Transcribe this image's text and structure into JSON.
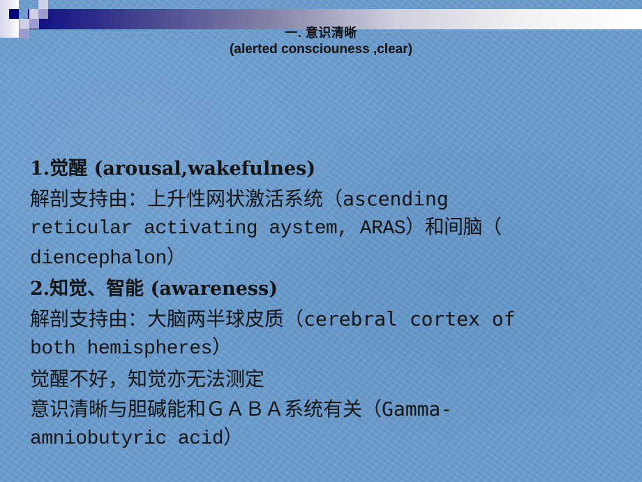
{
  "slide": {
    "title_cn": "一. 意识清晰",
    "title_en": "(alerted consciouness ,clear)",
    "lines": [
      {
        "text": "1.觉醒  (arousal,wakefulnes)",
        "style": "bold"
      },
      {
        "text": "解剖支持由：上升性网状激活系统（ascending",
        "style": "normal"
      },
      {
        "text": "reticular activating aystem, ARAS）和间脑（",
        "style": "normal"
      },
      {
        "text": "diencephalon）",
        "style": "normal"
      },
      {
        "text": "2.知觉、智能  (awareness)",
        "style": "bold"
      },
      {
        "text": "解剖支持由：大脑两半球皮质（cerebral cortex of",
        "style": "normal"
      },
      {
        "text": "both hemispheres）",
        "style": "normal"
      },
      {
        "text": "觉醒不好，知觉亦无法测定",
        "style": "normal"
      },
      {
        "text": "意识清晰与胆碱能和ＧＡＢＡ系统有关（Gamma-",
        "style": "normal"
      },
      {
        "text": "amniobutyric acid）",
        "style": "normal"
      }
    ]
  },
  "theme": {
    "background": "#6b9dcf",
    "accent_navy": "#06067a",
    "accent_lavender": "#9c9cce",
    "text": "#151515"
  }
}
